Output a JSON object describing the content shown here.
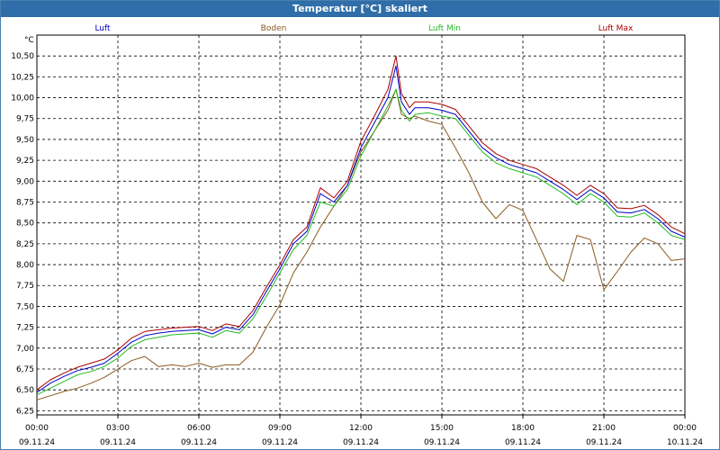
{
  "window": {
    "title": "Temperatur [°C] skaliert"
  },
  "chart_data": {
    "type": "line",
    "title": "Temperatur [°C] skaliert",
    "ylabel": "°C",
    "xlabel": "",
    "ylim": [
      6.2,
      10.75
    ],
    "xlim": [
      0,
      24
    ],
    "grid": true,
    "legend_position": "top",
    "y_ticks": [
      "6,25",
      "6,50",
      "6,75",
      "7,00",
      "7,25",
      "7,50",
      "7,75",
      "8,00",
      "8,25",
      "8,50",
      "8,75",
      "9,00",
      "9,25",
      "9,50",
      "9,75",
      "10,00",
      "10,25",
      "10,50"
    ],
    "x_ticks": [
      {
        "time": "00:00",
        "date": "09.11.24"
      },
      {
        "time": "03:00",
        "date": "09.11.24"
      },
      {
        "time": "06:00",
        "date": "09.11.24"
      },
      {
        "time": "09:00",
        "date": "09.11.24"
      },
      {
        "time": "12:00",
        "date": "09.11.24"
      },
      {
        "time": "15:00",
        "date": "09.11.24"
      },
      {
        "time": "18:00",
        "date": "09.11.24"
      },
      {
        "time": "21:00",
        "date": "09.11.24"
      },
      {
        "time": "00:00",
        "date": "10.11.24"
      }
    ],
    "x": [
      0,
      0.5,
      1,
      1.5,
      2,
      2.5,
      3,
      3.5,
      4,
      4.5,
      5,
      5.5,
      6,
      6.5,
      7,
      7.5,
      8,
      8.5,
      9,
      9.5,
      10,
      10.5,
      11,
      11.5,
      12,
      12.5,
      13,
      13.3,
      13.5,
      13.8,
      14,
      14.5,
      15,
      15.5,
      16,
      16.5,
      17,
      17.5,
      18,
      18.5,
      19,
      19.5,
      20,
      20.5,
      21,
      21.5,
      22,
      22.5,
      23,
      23.5,
      24
    ],
    "series": [
      {
        "name": "Luft",
        "color": "#0000cc",
        "values": [
          6.47,
          6.58,
          6.66,
          6.73,
          6.77,
          6.82,
          6.94,
          7.07,
          7.15,
          7.18,
          7.2,
          7.21,
          7.22,
          7.17,
          7.25,
          7.22,
          7.4,
          7.68,
          7.95,
          8.25,
          8.4,
          8.85,
          8.75,
          8.95,
          9.4,
          9.7,
          10.0,
          10.38,
          9.95,
          9.8,
          9.88,
          9.88,
          9.85,
          9.8,
          9.6,
          9.4,
          9.28,
          9.2,
          9.15,
          9.1,
          9.0,
          8.9,
          8.78,
          8.9,
          8.8,
          8.63,
          8.62,
          8.66,
          8.55,
          8.4,
          8.33
        ]
      },
      {
        "name": "Boden",
        "color": "#8b5a1e",
        "values": [
          6.38,
          6.43,
          6.48,
          6.52,
          6.58,
          6.65,
          6.75,
          6.85,
          6.9,
          6.78,
          6.8,
          6.78,
          6.82,
          6.77,
          6.8,
          6.8,
          6.95,
          7.25,
          7.52,
          7.9,
          8.15,
          8.45,
          8.7,
          8.95,
          9.35,
          9.6,
          9.85,
          10.1,
          9.8,
          9.75,
          9.78,
          9.72,
          9.68,
          9.4,
          9.1,
          8.75,
          8.55,
          8.72,
          8.65,
          8.3,
          7.95,
          7.8,
          8.35,
          8.3,
          7.7,
          7.92,
          8.15,
          8.32,
          8.25,
          8.05,
          8.07
        ]
      },
      {
        "name": "Luft Min",
        "color": "#22bb22",
        "values": [
          6.44,
          6.52,
          6.6,
          6.68,
          6.72,
          6.78,
          6.88,
          7.02,
          7.1,
          7.13,
          7.16,
          7.17,
          7.18,
          7.13,
          7.21,
          7.18,
          7.35,
          7.62,
          7.9,
          8.18,
          8.35,
          8.75,
          8.7,
          8.9,
          9.3,
          9.6,
          9.9,
          10.1,
          9.85,
          9.72,
          9.8,
          9.82,
          9.78,
          9.75,
          9.55,
          9.35,
          9.22,
          9.15,
          9.1,
          9.05,
          8.95,
          8.85,
          8.72,
          8.85,
          8.75,
          8.58,
          8.57,
          8.62,
          8.5,
          8.35,
          8.3
        ]
      },
      {
        "name": "Luft Max",
        "color": "#aa0000",
        "values": [
          6.5,
          6.62,
          6.7,
          6.77,
          6.82,
          6.87,
          6.98,
          7.12,
          7.2,
          7.22,
          7.24,
          7.25,
          7.26,
          7.21,
          7.29,
          7.26,
          7.45,
          7.73,
          8.0,
          8.3,
          8.45,
          8.92,
          8.8,
          9.0,
          9.48,
          9.78,
          10.1,
          10.5,
          10.05,
          9.88,
          9.95,
          9.95,
          9.92,
          9.86,
          9.66,
          9.46,
          9.33,
          9.25,
          9.2,
          9.15,
          9.05,
          8.95,
          8.83,
          8.95,
          8.85,
          8.68,
          8.67,
          8.71,
          8.6,
          8.45,
          8.37
        ]
      }
    ]
  }
}
